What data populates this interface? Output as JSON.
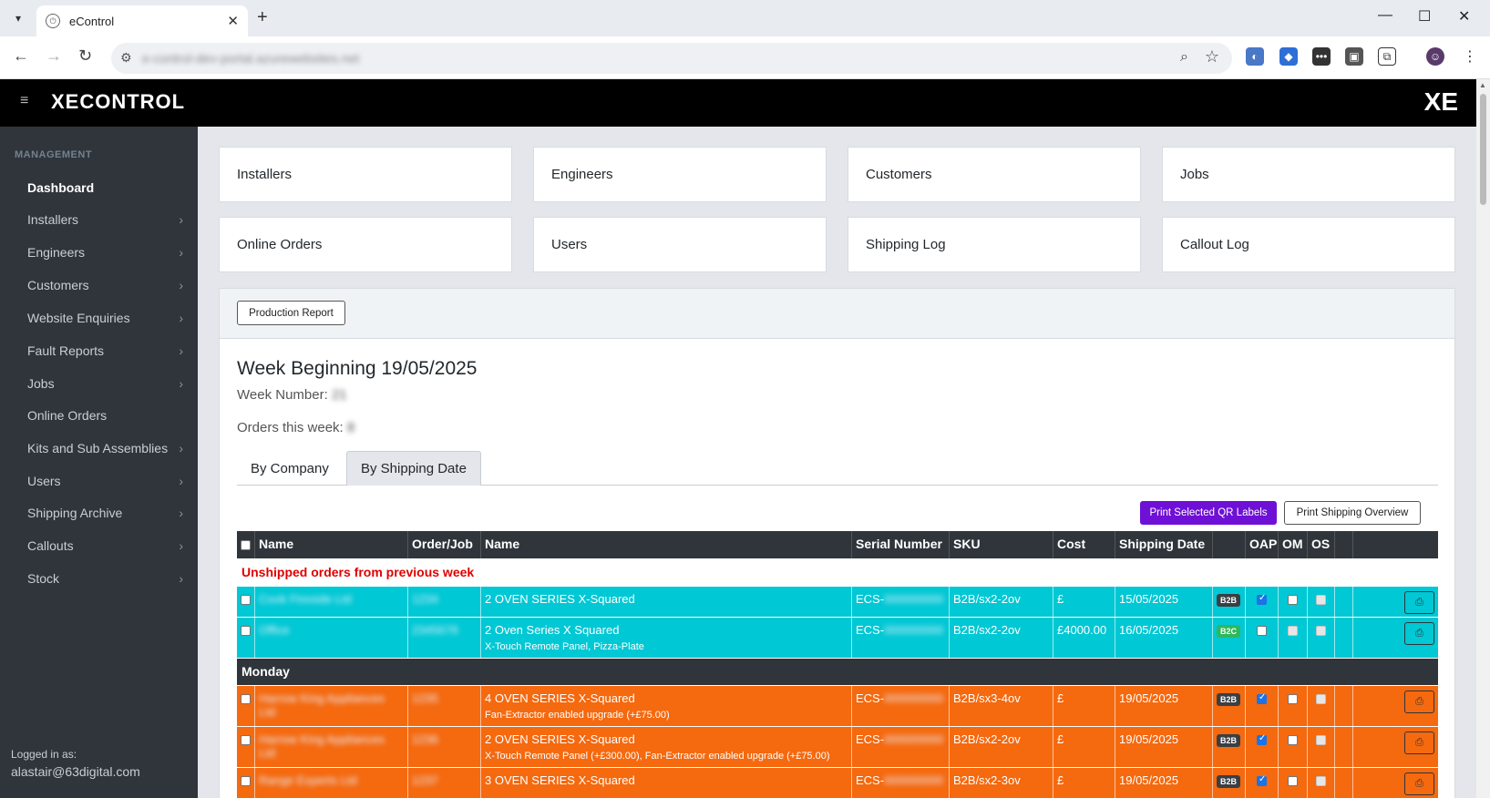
{
  "browser": {
    "tab_title": "eControl",
    "url": "e-control-dev-portal.azurewebsites.net"
  },
  "app": {
    "logo_text": "XECONTROL",
    "logo_right": "XE"
  },
  "sidebar": {
    "heading": "MANAGEMENT",
    "items": [
      {
        "label": "Dashboard"
      },
      {
        "label": "Installers"
      },
      {
        "label": "Engineers"
      },
      {
        "label": "Customers"
      },
      {
        "label": "Website Enquiries"
      },
      {
        "label": "Fault Reports"
      },
      {
        "label": "Jobs"
      },
      {
        "label": "Online Orders"
      },
      {
        "label": "Kits and Sub Assemblies"
      },
      {
        "label": "Users"
      },
      {
        "label": "Shipping Archive"
      },
      {
        "label": "Callouts"
      },
      {
        "label": "Stock"
      }
    ],
    "logged_in_label": "Logged in as:",
    "user_email": "alastair@63digital.com"
  },
  "cards": [
    {
      "label": "Installers"
    },
    {
      "label": "Engineers"
    },
    {
      "label": "Customers"
    },
    {
      "label": "Jobs"
    },
    {
      "label": "Online Orders"
    },
    {
      "label": "Users"
    },
    {
      "label": "Shipping Log"
    },
    {
      "label": "Callout Log"
    }
  ],
  "report": {
    "production_report_label": "Production Report",
    "week_title": "Week Beginning 19/05/2025",
    "week_number_label": "Week Number:",
    "week_number_value": "21",
    "orders_label": "Orders this week:",
    "orders_value": "8",
    "tabs": [
      {
        "label": "By Company"
      },
      {
        "label": "By Shipping Date"
      }
    ],
    "print_qr_label": "Print Selected QR Labels",
    "print_overview_label": "Print Shipping Overview"
  },
  "table": {
    "headers": [
      "Name",
      "Order/Job",
      "Name",
      "Serial Number",
      "SKU",
      "Cost",
      "Shipping Date",
      "",
      "OAP",
      "OM",
      "OS"
    ],
    "section_unshipped": "Unshipped orders from previous week",
    "section_monday": "Monday",
    "rows": [
      {
        "company": "Cook Fireside Ltd",
        "order": "1234",
        "product": "2 OVEN SERIES X-Squared",
        "extras": "",
        "serial": "ECS-",
        "serial_hidden": "000000000",
        "sku": "B2B/sx2-2ov",
        "cost": "£",
        "date": "15/05/2025",
        "type": "B2B",
        "oap": true,
        "om": false,
        "os": false
      },
      {
        "company": "Office",
        "order": "2345678",
        "product": "2 Oven Series X Squared",
        "extras": "X-Touch Remote Panel, Pizza-Plate",
        "serial": "ECS-",
        "serial_hidden": "000000000",
        "sku": "B2B/sx2-2ov",
        "cost": "£4000.00",
        "date": "16/05/2025",
        "type": "B2C",
        "oap": false,
        "om": false,
        "os": false
      },
      {
        "company": "Harrow King Appliances Ltd",
        "order": "1235",
        "product": "4 OVEN SERIES X-Squared",
        "extras": "Fan-Extractor enabled upgrade (+£75.00)",
        "serial": "ECS-",
        "serial_hidden": "000000000",
        "sku": "B2B/sx3-4ov",
        "cost": "£",
        "date": "19/05/2025",
        "type": "B2B",
        "oap": true,
        "om": false,
        "os": false
      },
      {
        "company": "Harrow King Appliances Ltd",
        "order": "1236",
        "product": "2 OVEN SERIES X-Squared",
        "extras": "X-Touch Remote Panel (+£300.00), Fan-Extractor enabled upgrade (+£75.00)",
        "serial": "ECS-",
        "serial_hidden": "000000000",
        "sku": "B2B/sx2-2ov",
        "cost": "£",
        "date": "19/05/2025",
        "type": "B2B",
        "oap": true,
        "om": false,
        "os": false
      },
      {
        "company": "Range Experts Ltd",
        "order": "1237",
        "product": "3 OVEN SERIES X-Squared",
        "extras": "",
        "serial": "ECS-",
        "serial_hidden": "000000000",
        "sku": "B2B/sx2-3ov",
        "cost": "£",
        "date": "19/05/2025",
        "type": "B2B",
        "oap": true,
        "om": false,
        "os": false
      }
    ]
  },
  "colors": {
    "cyan_row": "#00c8d4",
    "orange_row": "#f5690f",
    "purple_button": "#6f10d6",
    "sidebar_bg": "#2f353b"
  }
}
